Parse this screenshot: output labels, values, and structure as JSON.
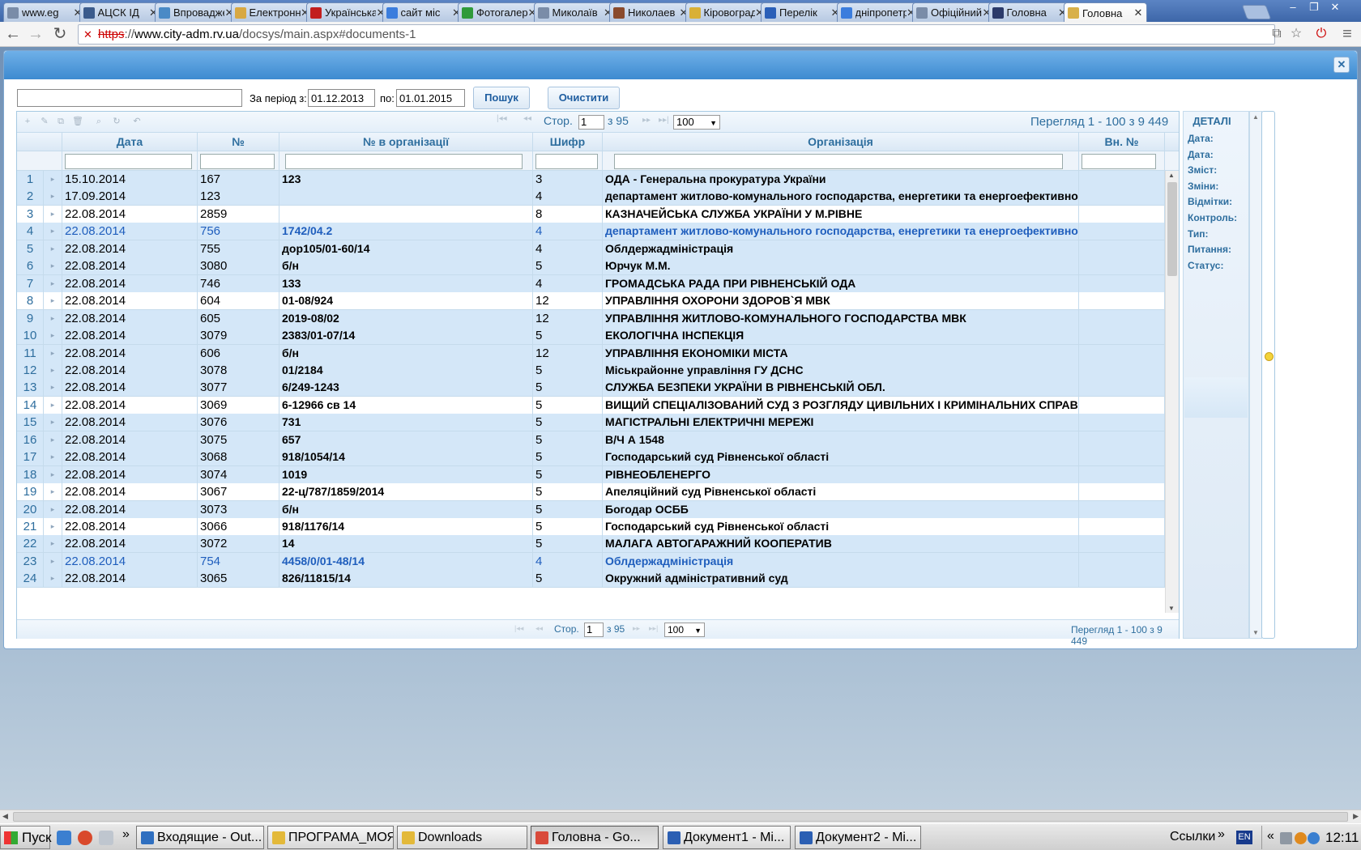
{
  "browser": {
    "tabs": [
      {
        "label": "www.eg",
        "icon": "page-icon",
        "color": "#7a8ca8"
      },
      {
        "label": "АЦСК ІД",
        "icon": "site-icon",
        "color": "#3b5b8c"
      },
      {
        "label": "Впровадження",
        "icon": "site-icon",
        "color": "#4a8ac6"
      },
      {
        "label": "Електронна",
        "icon": "site-icon",
        "color": "#d8a842"
      },
      {
        "label": "Українська",
        "icon": "site-icon",
        "color": "#c21e1e"
      },
      {
        "label": "сайт міс",
        "icon": "google-icon",
        "color": "#3b7ddd"
      },
      {
        "label": "Фотогалерея",
        "icon": "site-icon",
        "color": "#2f9a3a"
      },
      {
        "label": "Миколаїв",
        "icon": "page-icon",
        "color": "#7a8ca8"
      },
      {
        "label": "Николаев",
        "icon": "site-icon",
        "color": "#8a4a2c"
      },
      {
        "label": "Кіровоград",
        "icon": "site-icon",
        "color": "#d9b036"
      },
      {
        "label": "Перелік",
        "icon": "site-icon",
        "color": "#2a5fb8"
      },
      {
        "label": "дніпропетровськ",
        "icon": "google-icon",
        "color": "#3b7ddd"
      },
      {
        "label": "Офіційний",
        "icon": "page-icon",
        "color": "#7a8ca8"
      },
      {
        "label": "Головна",
        "icon": "site-icon",
        "color": "#2b3a6a"
      },
      {
        "label": "Головна",
        "icon": "site-icon",
        "color": "#d8b04a",
        "active": true
      }
    ],
    "close_glyph": "✕",
    "window_controls": [
      "‒",
      "❐",
      "✕"
    ],
    "url": {
      "scheme": "https",
      "sep": "://",
      "host": "www.city-adm.rv.ua",
      "path": "/docsys/main.aspx#documents-1"
    },
    "nav": {
      "back": "←",
      "forward": "→",
      "reload": "↻"
    },
    "bar_icons": {
      "translate": "⧉",
      "star": "☆",
      "ext": "⏻",
      "menu": "≡"
    }
  },
  "dialog": {
    "close": "✕",
    "search": {
      "query_value": "",
      "period_label": "За період з:",
      "date_from": "01.12.2013",
      "to_label": "по:",
      "date_to": "01.01.2015",
      "search_button": "Пошук",
      "clear_button": "Очистити"
    },
    "toolbar_icons": [
      "+",
      "✎",
      "⧉",
      "🗑",
      "⌕",
      "↻",
      "↶"
    ],
    "pager": {
      "page_label": "Стор.",
      "page_value": "1",
      "of_label": "з 95",
      "page_size": "100",
      "nav_first": "|◂◂",
      "nav_prev": "◂◂",
      "nav_next": "▸▸",
      "nav_last": "▸▸|",
      "summary": "Перегляд 1 - 100 з 9 449"
    },
    "columns": [
      "Дата",
      "№",
      "№ в організації",
      "Шифр",
      "Організація",
      "Вн. №"
    ],
    "rows": [
      {
        "n": "1",
        "date": "15.10.2014",
        "no": "167",
        "org_no": "123",
        "code": "3",
        "org": "ОДА - Генеральна прокуратура України",
        "in_no": ""
      },
      {
        "n": "2",
        "date": "17.09.2014",
        "no": "123",
        "org_no": "",
        "code": "4",
        "org": "департамент житлово-комунального господарства, енергетики та енергоефективності",
        "in_no": ""
      },
      {
        "n": "3",
        "date": "22.08.2014",
        "no": "2859",
        "org_no": "",
        "code": "8",
        "org": "КАЗНАЧЕЙСЬКА СЛУЖБА УКРАЇНИ У М.РІВНЕ",
        "in_no": ""
      },
      {
        "n": "4",
        "date": "22.08.2014",
        "no": "756",
        "org_no": "1742/04.2",
        "code": "4",
        "org": "департамент житлово-комунального господарства, енергетики та енергоефективності",
        "in_no": "",
        "hl": true
      },
      {
        "n": "5",
        "date": "22.08.2014",
        "no": "755",
        "org_no": "дор105/01-60/14",
        "code": "4",
        "org": "Облдержадміністрація",
        "in_no": ""
      },
      {
        "n": "6",
        "date": "22.08.2014",
        "no": "3080",
        "org_no": "б/н",
        "code": "5",
        "org": "Юрчук М.М.",
        "in_no": ""
      },
      {
        "n": "7",
        "date": "22.08.2014",
        "no": "746",
        "org_no": "133",
        "code": "4",
        "org": "ГРОМАДСЬКА РАДА ПРИ РІВНЕНСЬКІЙ ОДА",
        "in_no": ""
      },
      {
        "n": "8",
        "date": "22.08.2014",
        "no": "604",
        "org_no": "01-08/924",
        "code": "12",
        "org": "УПРАВЛІННЯ ОХОРОНИ ЗДОРОВ`Я МВК",
        "in_no": ""
      },
      {
        "n": "9",
        "date": "22.08.2014",
        "no": "605",
        "org_no": "2019-08/02",
        "code": "12",
        "org": "УПРАВЛІННЯ ЖИТЛОВО-КОМУНАЛЬНОГО ГОСПОДАРСТВА МВК",
        "in_no": ""
      },
      {
        "n": "10",
        "date": "22.08.2014",
        "no": "3079",
        "org_no": "2383/01-07/14",
        "code": "5",
        "org": "ЕКОЛОГІЧНА ІНСПЕКЦІЯ",
        "in_no": ""
      },
      {
        "n": "11",
        "date": "22.08.2014",
        "no": "606",
        "org_no": "б/н",
        "code": "12",
        "org": "УПРАВЛІННЯ ЕКОНОМІКИ МІСТА",
        "in_no": ""
      },
      {
        "n": "12",
        "date": "22.08.2014",
        "no": "3078",
        "org_no": "01/2184",
        "code": "5",
        "org": "Міськрайонне управління  ГУ ДСНС",
        "in_no": ""
      },
      {
        "n": "13",
        "date": "22.08.2014",
        "no": "3077",
        "org_no": "6/249-1243",
        "code": "5",
        "org": "СЛУЖБА БЕЗПЕКИ УКРАЇНИ В РІВНЕНСЬКІЙ ОБЛ.",
        "in_no": ""
      },
      {
        "n": "14",
        "date": "22.08.2014",
        "no": "3069",
        "org_no": "6-12966 св 14",
        "code": "5",
        "org": "ВИЩИЙ СПЕЦІАЛІЗОВАНИЙ СУД З РОЗГЛЯДУ ЦИВІЛЬНИХ І КРИМІНАЛЬНИХ СПРАВ",
        "in_no": ""
      },
      {
        "n": "15",
        "date": "22.08.2014",
        "no": "3076",
        "org_no": "731",
        "code": "5",
        "org": "МАГІСТРАЛЬНІ ЕЛЕКТРИЧНІ МЕРЕЖІ",
        "in_no": ""
      },
      {
        "n": "16",
        "date": "22.08.2014",
        "no": "3075",
        "org_no": "657",
        "code": "5",
        "org": "В/Ч А 1548",
        "in_no": ""
      },
      {
        "n": "17",
        "date": "22.08.2014",
        "no": "3068",
        "org_no": "918/1054/14",
        "code": "5",
        "org": "Господарський суд Рівненської області",
        "in_no": ""
      },
      {
        "n": "18",
        "date": "22.08.2014",
        "no": "3074",
        "org_no": "1019",
        "code": "5",
        "org": "РІВНЕОБЛЕНЕРГО",
        "in_no": ""
      },
      {
        "n": "19",
        "date": "22.08.2014",
        "no": "3067",
        "org_no": "22-ц/787/1859/2014",
        "code": "5",
        "org": "Апеляційний суд Рівненської області",
        "in_no": ""
      },
      {
        "n": "20",
        "date": "22.08.2014",
        "no": "3073",
        "org_no": "б/н",
        "code": "5",
        "org": "Богодар ОСББ",
        "in_no": ""
      },
      {
        "n": "21",
        "date": "22.08.2014",
        "no": "3066",
        "org_no": "918/1176/14",
        "code": "5",
        "org": "Господарський суд Рівненської області",
        "in_no": ""
      },
      {
        "n": "22",
        "date": "22.08.2014",
        "no": "3072",
        "org_no": "14",
        "code": "5",
        "org": "МАЛАГА АВТОГАРАЖНИЙ КООПЕРАТИВ",
        "in_no": ""
      },
      {
        "n": "23",
        "date": "22.08.2014",
        "no": "754",
        "org_no": "4458/0/01-48/14",
        "code": "4",
        "org": "Облдержадміністрація",
        "in_no": "",
        "hl": true
      },
      {
        "n": "24",
        "date": "22.08.2014",
        "no": "3065",
        "org_no": "826/11815/14",
        "code": "5",
        "org": "Окружний адміністративний суд",
        "in_no": ""
      }
    ],
    "details": {
      "title": "ДЕТАЛІ",
      "labels": [
        "Дата:",
        "Дата:",
        "Зміст:",
        "Зміни:",
        "Відмітки:",
        "Контроль:",
        "Тип:",
        "Питання:",
        "Статус:"
      ]
    }
  },
  "taskbar": {
    "start": "Пуск",
    "quicklaunch_more": "»",
    "tasks": [
      {
        "label": "Входящие - Out...",
        "color": "#2f6fc0",
        "icon": "outlook-icon"
      },
      {
        "label": "ПРОГРАМА_МОЯ",
        "color": "#e3b93a",
        "icon": "folder-icon"
      },
      {
        "label": "Downloads",
        "color": "#e3b93a",
        "icon": "folder-icon"
      },
      {
        "label": "Головна - Go...",
        "color": "#d94a3a",
        "icon": "chrome-icon",
        "active": true
      },
      {
        "label": "Документ1 - Mi...",
        "color": "#2b5fb3",
        "icon": "word-icon"
      },
      {
        "label": "Документ2 - Mi...",
        "color": "#2b5fb3",
        "icon": "word-icon"
      }
    ],
    "links_label": "Ссылки",
    "links_more": "»",
    "lang": "EN",
    "tray_more": "«",
    "clock": "12:11"
  }
}
